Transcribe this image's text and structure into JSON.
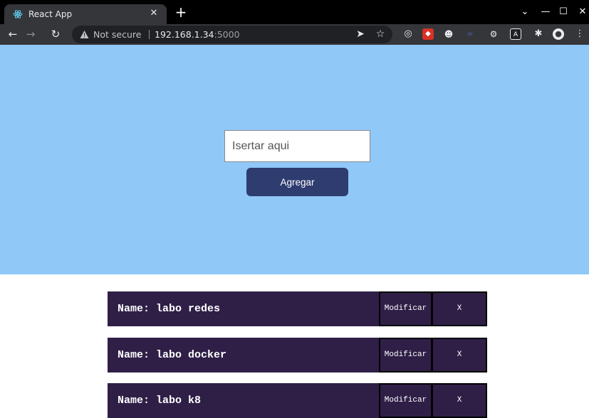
{
  "browser": {
    "tab": {
      "title": "React App",
      "favicon": "react-icon",
      "close_label": "✕"
    },
    "new_tab_label": "+",
    "window_controls": {
      "dropdown": "⌄",
      "minimize": "—",
      "maximize": "☐",
      "close": "✕"
    },
    "security_label": "Not secure",
    "url_host": "192.168.1.34",
    "url_port": ":5000"
  },
  "form": {
    "input_placeholder": "Isertar aqui",
    "input_value": "",
    "add_label": "Agregar"
  },
  "items": [
    {
      "label": "Name:",
      "name": "labo redes",
      "edit_label": "Modificar",
      "delete_label": "X"
    },
    {
      "label": "Name:",
      "name": "labo docker",
      "edit_label": "Modificar",
      "delete_label": "X"
    },
    {
      "label": "Name:",
      "name": "labo k8",
      "edit_label": "Modificar",
      "delete_label": "X"
    }
  ],
  "colors": {
    "hero_bg": "#90c8f8",
    "button_bg": "#2f3c6f",
    "item_bg": "#2f1f47"
  }
}
